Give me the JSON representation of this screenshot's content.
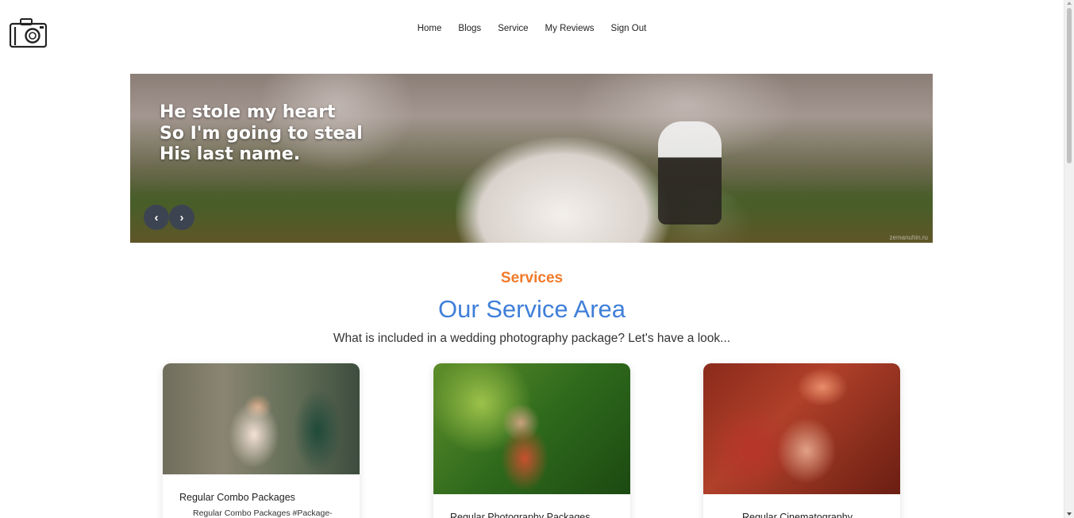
{
  "nav": {
    "items": [
      "Home",
      "Blogs",
      "Service",
      "My Reviews",
      "Sign Out"
    ]
  },
  "hero": {
    "lines": [
      "He stole my heart",
      "So I'm going to steal",
      "His last name."
    ],
    "prev_label": "‹",
    "next_label": "›",
    "watermark": "zemanuhin.ru"
  },
  "services": {
    "eyebrow": "Services",
    "title": "Our Service Area",
    "subtitle": "What is included in a wedding photography package? Let's have a look..."
  },
  "cards": [
    {
      "title": "Regular Combo Packages",
      "description": "Regular Combo Packages #Package-"
    },
    {
      "title": "Regular Photography Packages"
    },
    {
      "title": "Regular Cinematography"
    }
  ],
  "colors": {
    "accent_orange": "#f07a2a",
    "accent_blue": "#3f7fd9",
    "carousel_button": "#3d4451"
  },
  "icons": {
    "logo": "camera-icon"
  }
}
